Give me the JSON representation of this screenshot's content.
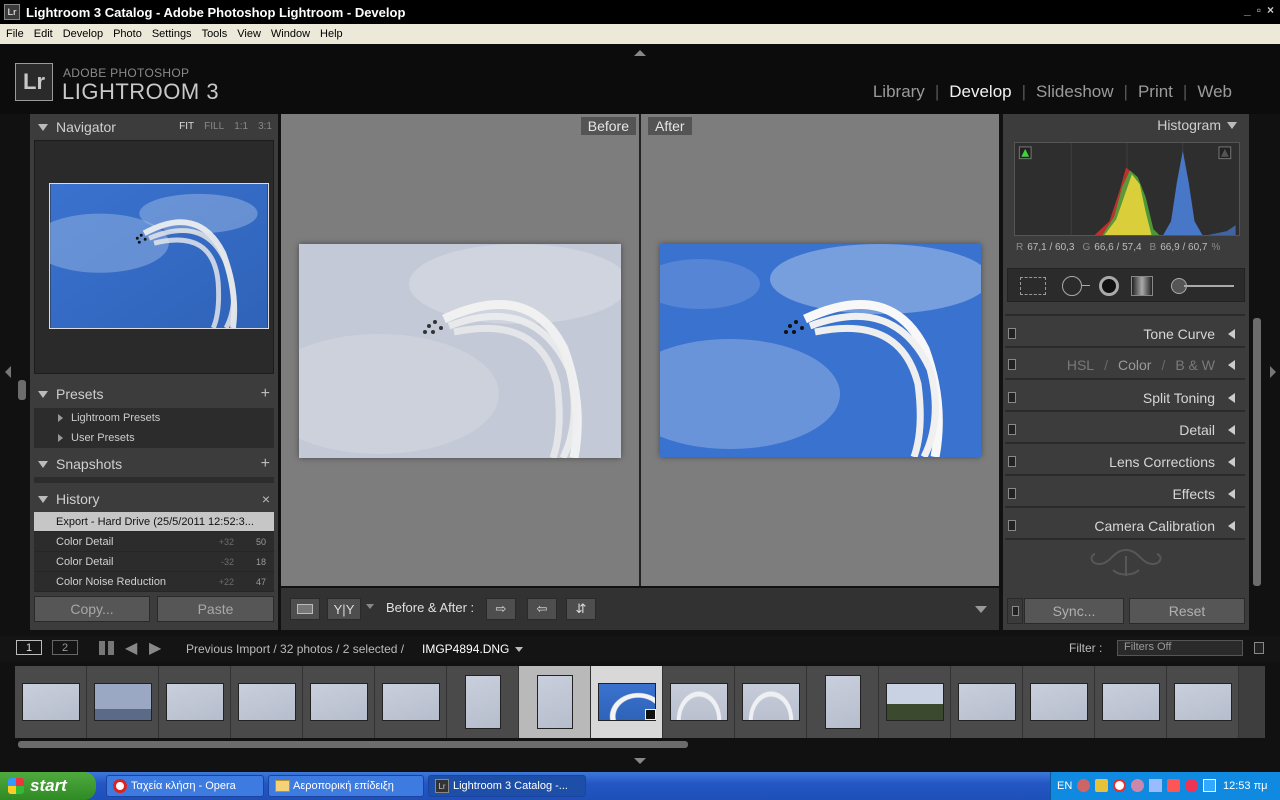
{
  "window": {
    "title": "Lightroom 3 Catalog - Adobe Photoshop Lightroom - Develop",
    "icon": "Lr",
    "controls": [
      "_",
      "▫",
      "×"
    ]
  },
  "menu": [
    "File",
    "Edit",
    "Develop",
    "Photo",
    "Settings",
    "Tools",
    "View",
    "Window",
    "Help"
  ],
  "brand": {
    "logo": "Lr",
    "line1": "ADOBE PHOTOSHOP",
    "line2": "LIGHTROOM 3"
  },
  "modules": [
    {
      "label": "Library",
      "active": false
    },
    {
      "label": "Develop",
      "active": true
    },
    {
      "label": "Slideshow",
      "active": false
    },
    {
      "label": "Print",
      "active": false
    },
    {
      "label": "Web",
      "active": false
    }
  ],
  "left": {
    "navigator": {
      "title": "Navigator",
      "options": [
        "FIT",
        "FILL",
        "1:1",
        "3:1"
      ],
      "selected": "FIT"
    },
    "presets": {
      "title": "Presets",
      "items": [
        "Lightroom Presets",
        "User Presets"
      ]
    },
    "snapshots": {
      "title": "Snapshots"
    },
    "history": {
      "title": "History",
      "close": "×",
      "items": [
        {
          "label": "Export - Hard Drive (25/5/2011 12:52:3...",
          "d1": "",
          "d2": "",
          "selected": true
        },
        {
          "label": "Color Detail",
          "d1": "+32",
          "d2": "50",
          "selected": false
        },
        {
          "label": "Color Detail",
          "d1": "-32",
          "d2": "18",
          "selected": false
        },
        {
          "label": "Color Noise Reduction",
          "d1": "+22",
          "d2": "47",
          "selected": false
        }
      ]
    },
    "copy": "Copy...",
    "paste": "Paste"
  },
  "center": {
    "before_label": "Before",
    "after_label": "After",
    "toolbar": {
      "view_label": "Y|Y",
      "mode_label": "Before & After :"
    }
  },
  "right": {
    "histogram": {
      "title": "Histogram",
      "r": "R",
      "r_val": "67,1 / 60,3",
      "g": "G",
      "g_val": "66,6 / 57,4",
      "b": "B",
      "b_val": "66,9 / 60,7",
      "pct": "%"
    },
    "sections": [
      {
        "label": "Tone Curve"
      },
      {
        "label": "HSL / Color / B&W",
        "hsl": "HSL",
        "color": "Color",
        "bw": "B & W"
      },
      {
        "label": "Split Toning"
      },
      {
        "label": "Detail"
      },
      {
        "label": "Lens Corrections"
      },
      {
        "label": "Effects"
      },
      {
        "label": "Camera Calibration"
      }
    ],
    "sync": "Sync...",
    "reset": "Reset"
  },
  "filmstrip": {
    "view1": "1",
    "view2": "2",
    "source": "Previous Import / 32 photos / 2 selected /",
    "file": "IMGP4894.DNG",
    "filter_label": "Filter :",
    "filter_value": "Filters Off"
  },
  "taskbar": {
    "start": "start",
    "tasks": [
      "Ταχεία κλήση - Opera",
      "Αεροπορική επίδειξη",
      "Lightroom 3 Catalog -..."
    ],
    "lang": "EN",
    "clock": "12:53 πμ"
  },
  "colors": {
    "sky_blue": "#3f78c9",
    "panel": "#3c3c3c",
    "canvas": "#7d7d7d"
  },
  "icons": [
    "lightroom-icon",
    "disclosure-triangle-icon",
    "plus-icon",
    "close-icon",
    "grid-icon",
    "arrow-left-icon",
    "arrow-right-icon",
    "swap-icon",
    "crop-icon",
    "spot-removal-icon",
    "red-eye-icon",
    "gradient-icon",
    "brush-icon",
    "opera-icon",
    "folder-icon",
    "windows-icon"
  ]
}
